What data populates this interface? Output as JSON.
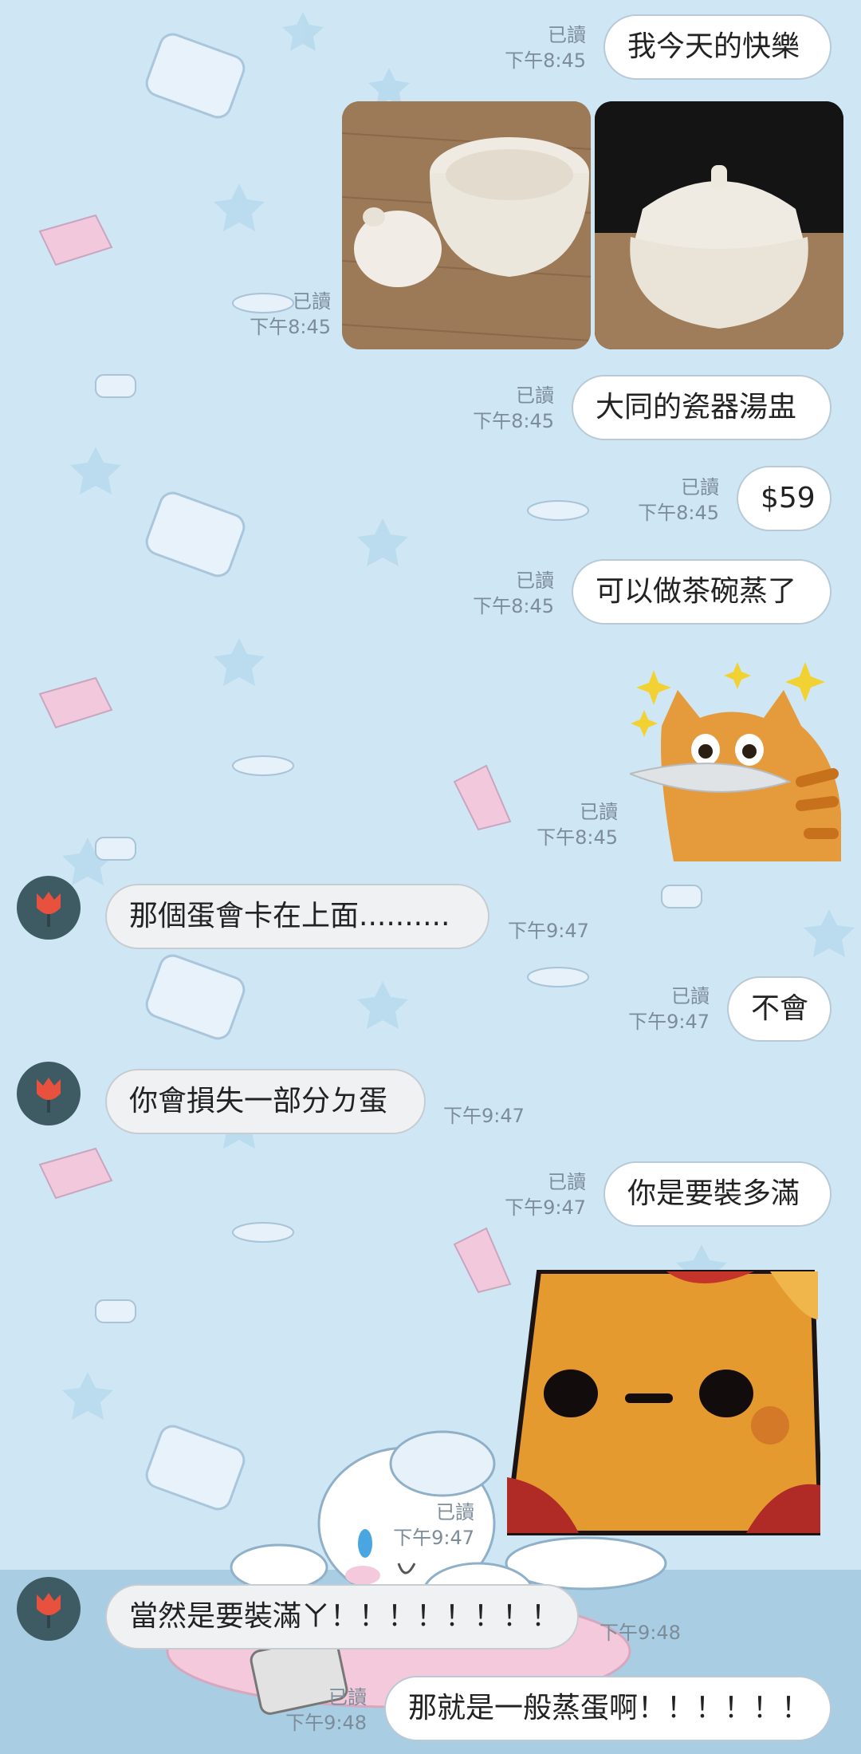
{
  "theme": {
    "background": "#cfe7f5",
    "floor": "#a9cde3",
    "bubble_out": "#ffffff",
    "bubble_in": "#f0f1f3",
    "avatar_bg": "#3e5a62",
    "avatar_flower": "#e8513e"
  },
  "messages": [
    {
      "id": "m1",
      "text": "我今天的快樂",
      "read": "已讀",
      "time": "下午8:45"
    },
    {
      "id": "m2",
      "read": "已讀",
      "time": "下午8:45",
      "photos": [
        "bowl-lid-open-photo",
        "bowl-lid-closed-photo"
      ]
    },
    {
      "id": "m3",
      "text": "大同的瓷器湯盅",
      "read": "已讀",
      "time": "下午8:45"
    },
    {
      "id": "m4",
      "text": "$59",
      "read": "已讀",
      "time": "下午8:45"
    },
    {
      "id": "m5",
      "text": "可以做茶碗蒸了",
      "read": "已讀",
      "time": "下午8:45"
    },
    {
      "id": "m6",
      "read": "已讀",
      "time": "下午8:45",
      "sticker": "cat-with-fish-sticker"
    },
    {
      "id": "m7",
      "text": "那個蛋會卡在上面..........",
      "time": "下午9:47"
    },
    {
      "id": "m8",
      "text": "不會",
      "read": "已讀",
      "time": "下午9:47"
    },
    {
      "id": "m9",
      "text": "你會損失一部分ㄉ蛋",
      "time": "下午9:47"
    },
    {
      "id": "m10",
      "text": "你是要裝多滿",
      "read": "已讀",
      "time": "下午9:47"
    },
    {
      "id": "m11",
      "read": "已讀",
      "time": "下午9:47",
      "sticker": "bread-face-sticker"
    },
    {
      "id": "m12",
      "text": "當然是要裝滿ㄚ！！！！！！！！",
      "time": "下午9:48"
    },
    {
      "id": "m13",
      "text": "那就是一般蒸蛋啊！！！！！！",
      "read": "已讀",
      "time": "下午9:48"
    }
  ]
}
